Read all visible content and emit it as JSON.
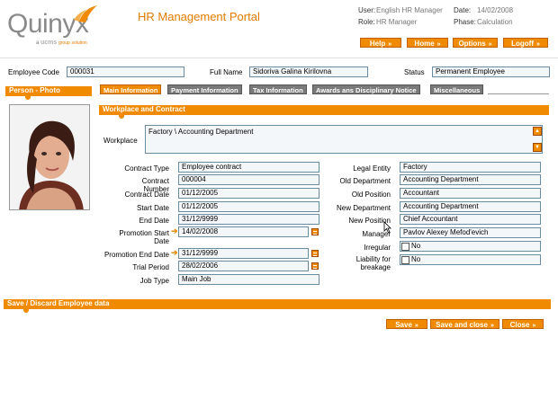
{
  "header": {
    "logo_text": "Quinyx",
    "logo_sub_by": "a",
    "logo_sub_brand": "ucms",
    "logo_sub_group": "group",
    "logo_sub_solution": "solution",
    "portal_title": "HR Management Portal",
    "user_label": "User:",
    "user_value": "English HR Manager",
    "date_label": "Date:",
    "date_value": "14/02/2008",
    "role_label": "Role:",
    "role_value": "HR Manager",
    "phase_label": "Phase:",
    "phase_value": "Calculation",
    "buttons": {
      "help": "Help",
      "home": "Home",
      "options": "Options",
      "logoff": "Logoff"
    },
    "arrow": "»"
  },
  "employee": {
    "code_label": "Employee Code",
    "code_value": "000031",
    "fullname_label": "Full Name",
    "fullname_value": "Sidoriva Galina Kirilovna",
    "status_label": "Status",
    "status_value": "Permanent Employee"
  },
  "person_photo_title": "Person - Photo",
  "tabs": [
    "Main Information",
    "Payment Information",
    "Tax Information",
    "Awards ans Disciplinary Notice",
    "Miscellaneous"
  ],
  "section_title": "Workplace and Contract",
  "workplace": {
    "label": "Workplace",
    "value": "Factory \\ Accounting Department"
  },
  "left_fields": {
    "contract_type": {
      "label": "Contract Type",
      "value": "Employee contract"
    },
    "contract_number": {
      "label": "Contract Number",
      "value": "000004"
    },
    "contract_date": {
      "label": "Contract Date",
      "value": "01/12/2005"
    },
    "start_date": {
      "label": "Start Date",
      "value": "01/12/2005"
    },
    "end_date": {
      "label": "End Date",
      "value": "31/12/9999"
    },
    "promotion_start": {
      "label1": "Promotion Start",
      "label2": "Date",
      "value": "14/02/2008"
    },
    "promotion_end": {
      "label": "Promotion End Date",
      "value": "31/12/9999"
    },
    "trial_period": {
      "label": "Trial Period",
      "value": "28/02/2006"
    },
    "job_type": {
      "label": "Job Type",
      "value": "Main Job"
    }
  },
  "right_fields": {
    "legal_entity": {
      "label": "Legal Entity",
      "value": "Factory"
    },
    "old_department": {
      "label": "Old Department",
      "value": "Accounting Department"
    },
    "old_position": {
      "label": "Old Position",
      "value": "Accountant"
    },
    "new_department": {
      "label": "New Department",
      "value": "Accounting Department"
    },
    "new_position": {
      "label": "New Position",
      "value": "Chief Accountant"
    },
    "manager": {
      "label": "Manager",
      "value": "Pavlov Alexey Mefod'evich"
    },
    "irregular": {
      "label": "Irregular",
      "value": "No"
    },
    "liability": {
      "label1": "Liability for",
      "label2": "breakage",
      "value": "No"
    }
  },
  "save_section_title": "Save / Discard Employee data",
  "bottom_buttons": {
    "save": "Save",
    "save_close": "Save and close",
    "close": "Close"
  },
  "colors": {
    "accent": "#f08a00",
    "tab_inactive": "#7a7a7a",
    "field_border": "#6a8ca0"
  }
}
